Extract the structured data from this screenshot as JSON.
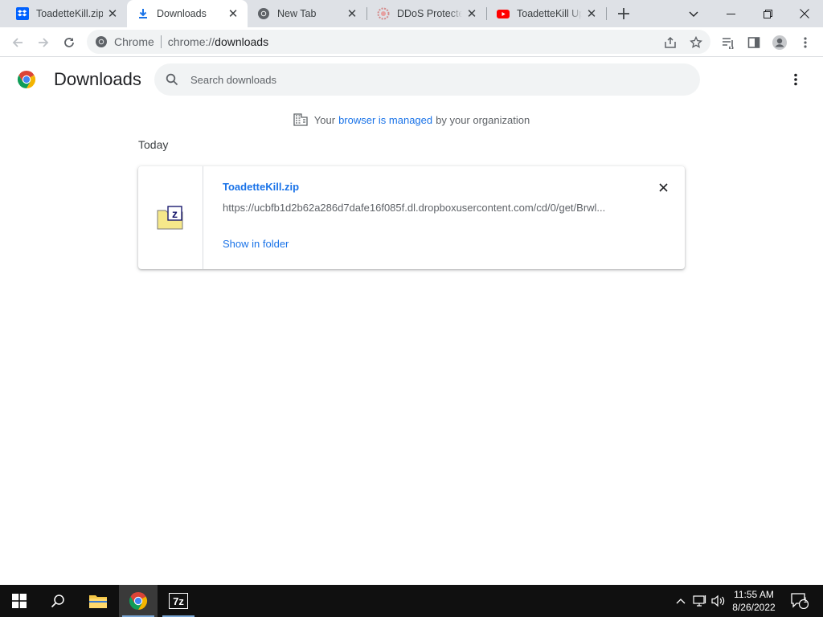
{
  "browser": {
    "tabs": [
      {
        "title": "ToadetteKill.zip",
        "favicon": "dropbox-icon",
        "active": false
      },
      {
        "title": "Downloads",
        "favicon": "download-icon",
        "active": true
      },
      {
        "title": "New Tab",
        "favicon": "chrome-icon",
        "active": false
      },
      {
        "title": "DDoS Protected",
        "favicon": "ddos-guard-icon",
        "active": false
      },
      {
        "title": "ToadetteKill Up",
        "favicon": "youtube-icon",
        "active": false
      }
    ],
    "omnibox": {
      "chip": "Chrome",
      "scheme": "chrome://",
      "host": "downloads"
    }
  },
  "page": {
    "title": "Downloads",
    "search_placeholder": "Search downloads",
    "managed": {
      "prefix": "Your",
      "link": "browser is managed",
      "suffix": "by your organization"
    },
    "section_date": "Today",
    "downloads": [
      {
        "file_name": "ToadetteKill.zip",
        "url": "https://ucbfb1d2b62a286d7dafe16f085f.dl.dropboxusercontent.com/cd/0/get/Brwl...",
        "action": "Show in folder",
        "icon": "7zip-archive-icon"
      }
    ]
  },
  "taskbar": {
    "time": "11:55 AM",
    "date": "8/26/2022",
    "notification_count": "1"
  },
  "colors": {
    "accent": "#1a73e8",
    "tabstrip": "#dee1e6",
    "taskbar": "#101010"
  }
}
